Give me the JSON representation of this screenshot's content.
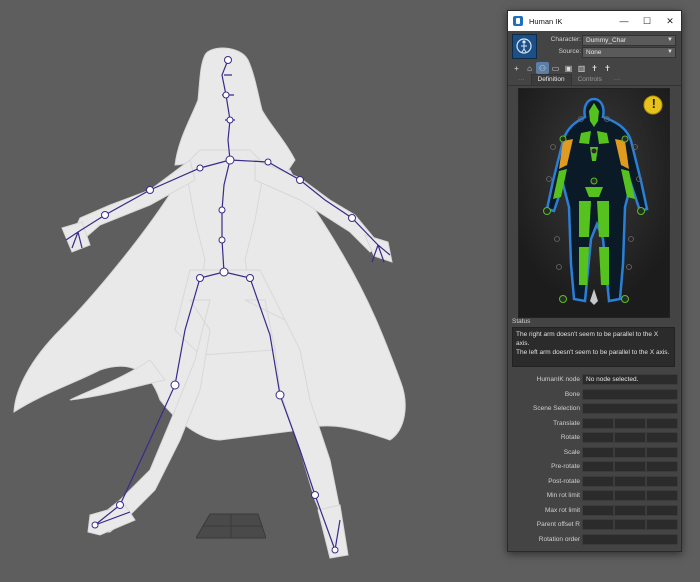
{
  "window": {
    "title": "Human IK",
    "minimize": "—",
    "maximize": "☐",
    "close": "✕"
  },
  "character": {
    "label": "Character:",
    "value": "Dummy_Char",
    "source_label": "Source:",
    "source_value": "None"
  },
  "toolbar": {
    "tools": [
      "add-icon",
      "lock-icon",
      "definition-icon",
      "folder-icon",
      "save-icon",
      "delete-icon",
      "character-icon",
      "pose-icon"
    ]
  },
  "tabs": {
    "definition": "Definition",
    "controls": "Controls"
  },
  "status": {
    "label": "Status",
    "line1": "The right arm doesn't seem to be parallel to the X axis.",
    "line2": "The left arm doesn't seem to be parallel to the X axis.",
    "warning": "!"
  },
  "properties": {
    "humanik_node_label": "HumanIK node",
    "humanik_node_value": "No node selected.",
    "bone_label": "Bone",
    "scene_selection_label": "Scene Selection",
    "translate_label": "Translate",
    "rotate_label": "Rotate",
    "scale_label": "Scale",
    "pre_rotate_label": "Pre-rotate",
    "post_rotate_label": "Post-rotate",
    "min_rot_limit_label": "Min rot limit",
    "max_rot_limit_label": "Max rot limit",
    "parent_offset_label": "Parent offset R",
    "rotation_order_label": "Rotation order"
  },
  "colors": {
    "viewport": "#5e5e5e",
    "panel": "#444444",
    "limb_green": "#56c21f",
    "limb_orange": "#e09a1f",
    "outline_blue": "#2b7fd6",
    "warning_yellow": "#e6c21a",
    "skeleton": "#3a2a8a"
  }
}
